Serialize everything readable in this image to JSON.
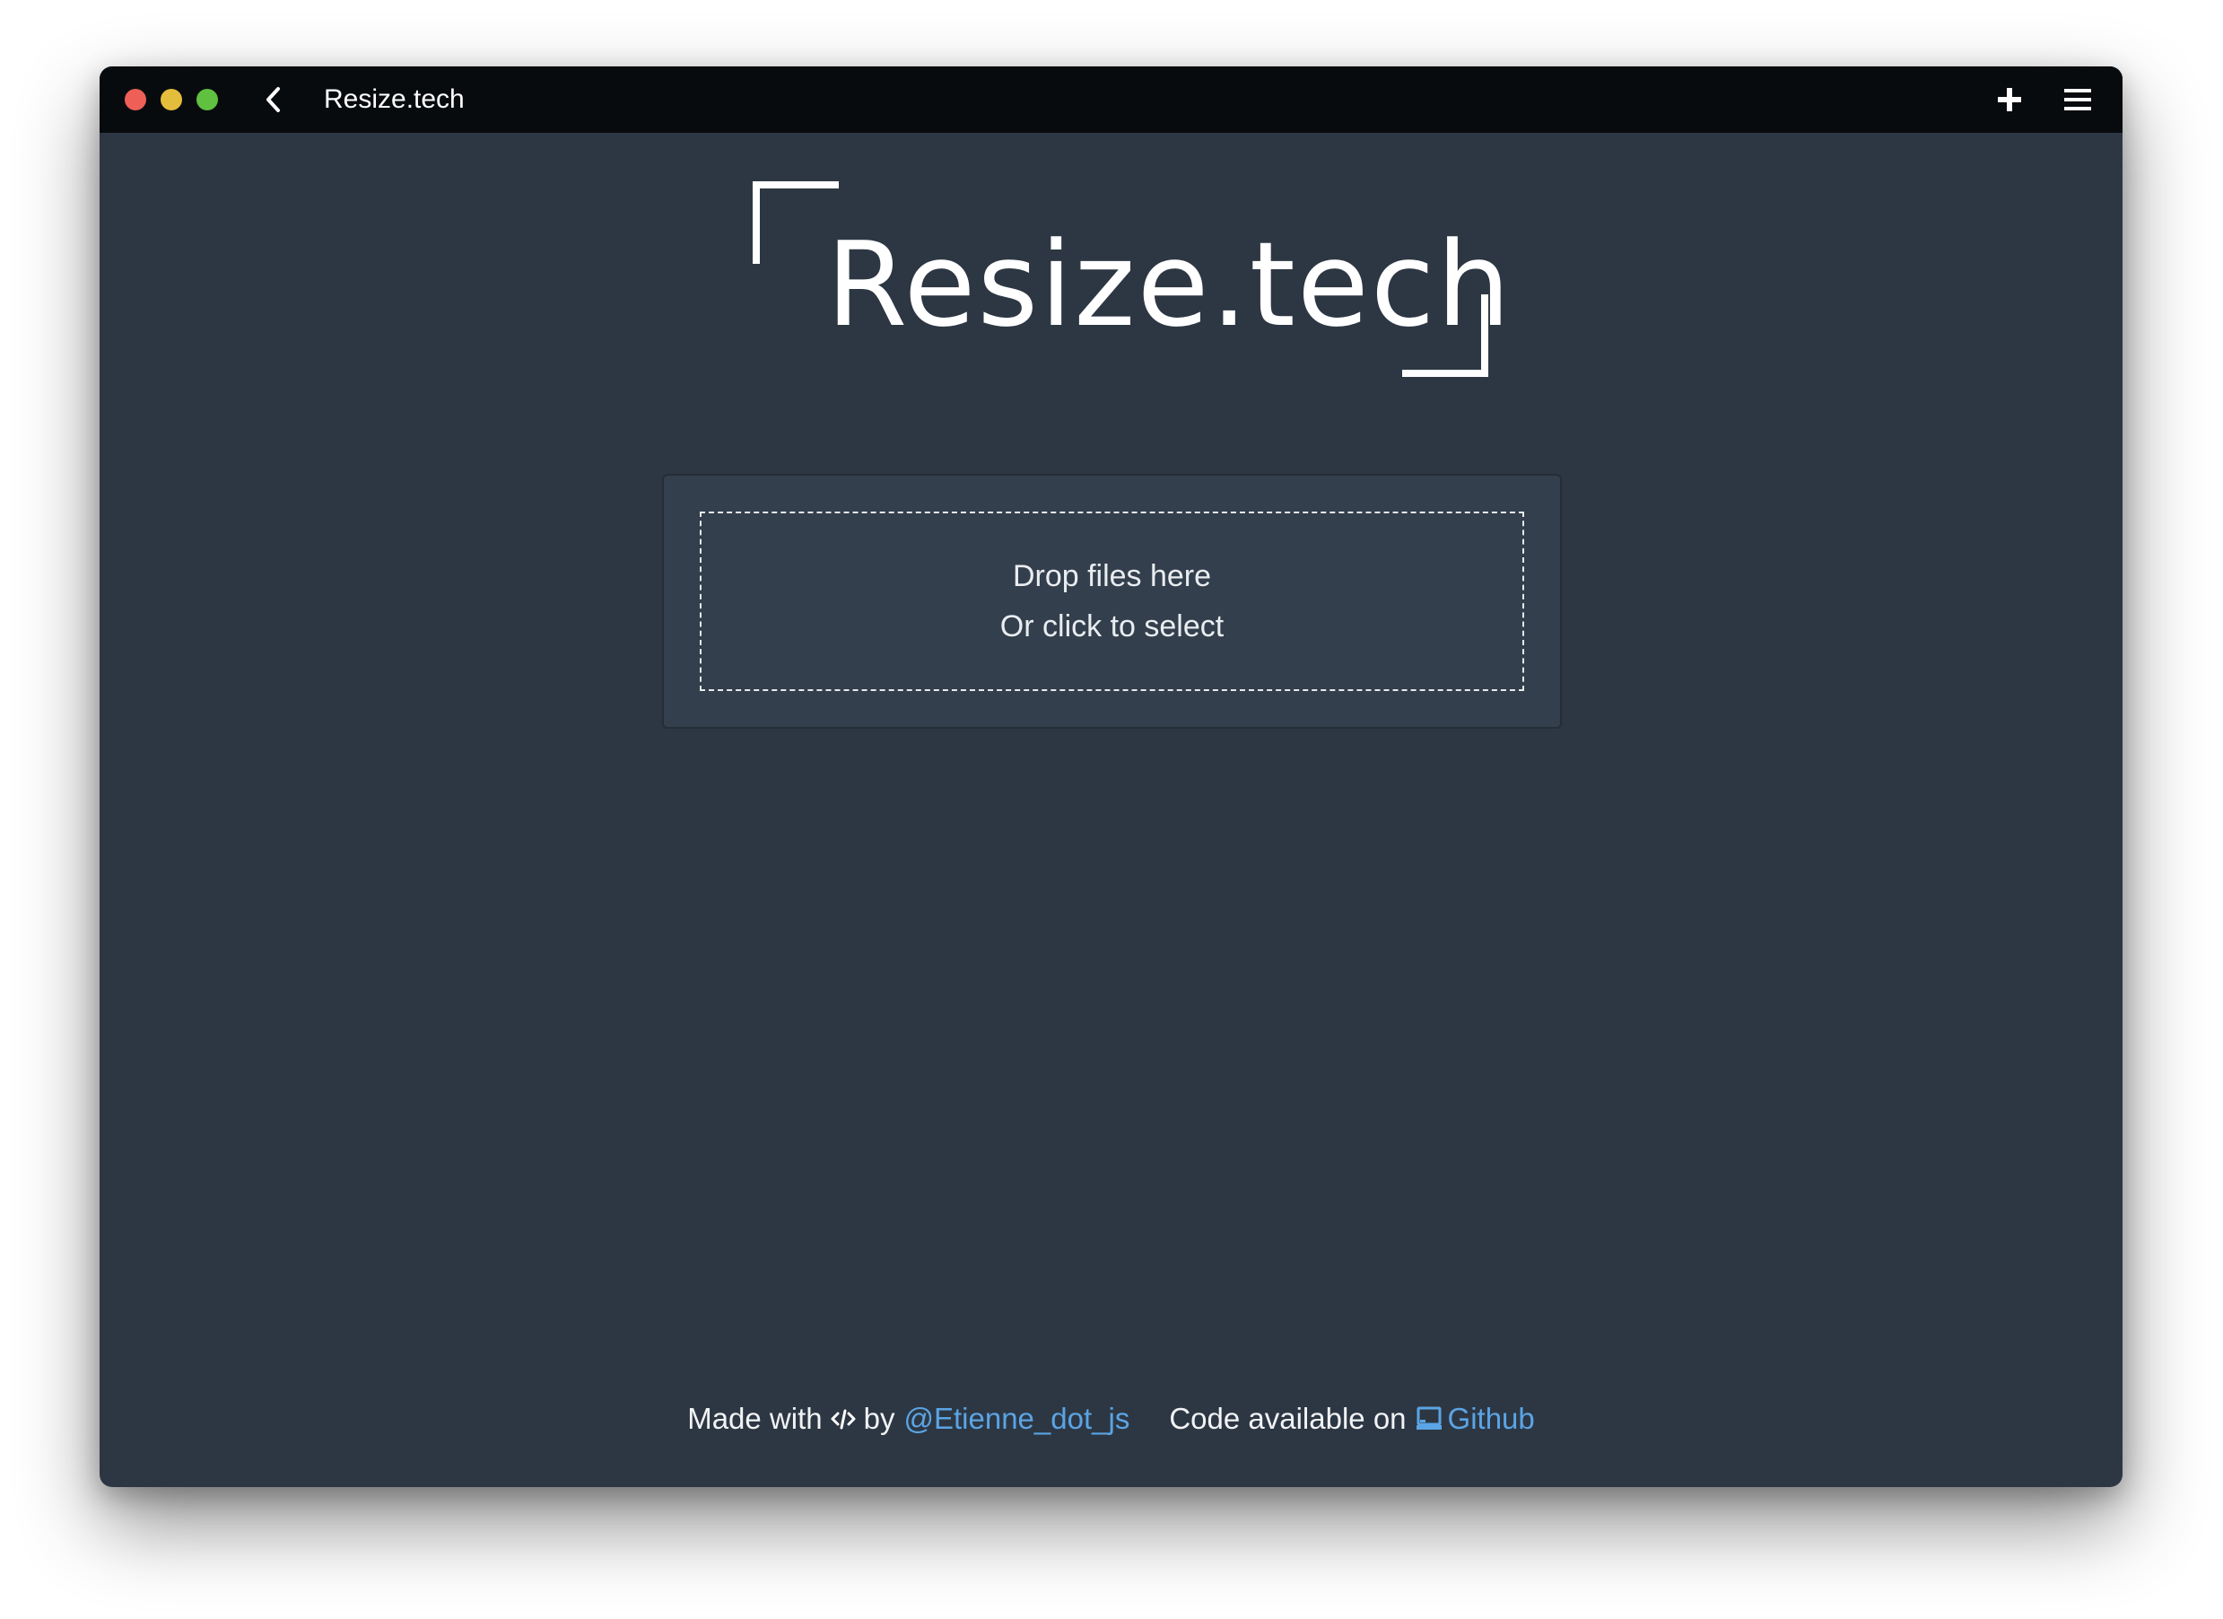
{
  "window": {
    "title": "Resize.tech",
    "icons": {
      "back": "chevron-left-icon",
      "add": "plus-icon",
      "menu": "hamburger-menu-icon"
    }
  },
  "logo": {
    "text": "Resize.tech"
  },
  "dropzone": {
    "line1": "Drop files here",
    "line2": "Or click to select"
  },
  "footer": {
    "made_with": "Made with",
    "by": "by",
    "author_link": "@Etienne_dot_js",
    "code_available": "Code available on",
    "github_link": "Github"
  },
  "colors": {
    "background": "#2d3743",
    "titlebar": "#080b0e",
    "card": "#333f4c",
    "link": "#5ba4e5"
  }
}
